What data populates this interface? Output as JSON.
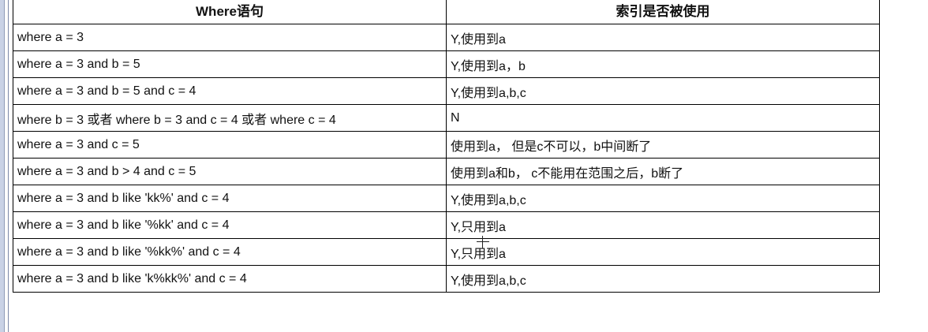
{
  "table": {
    "headers": [
      "Where语句",
      "索引是否被使用"
    ],
    "rows": [
      {
        "where": "where a = 3",
        "used": "Y,使用到a"
      },
      {
        "where": "where a = 3 and b = 5",
        "used": "Y,使用到a，b"
      },
      {
        "where": "where a = 3 and b = 5 and c = 4",
        "used": "Y,使用到a,b,c"
      },
      {
        "where": "where b = 3 或者 where b = 3 and c = 4  或者 where c = 4",
        "used": "N"
      },
      {
        "where": "where a = 3 and c = 5",
        "used": "使用到a， 但是c不可以，b中间断了"
      },
      {
        "where": "where a = 3 and b > 4 and c = 5",
        "used": "使用到a和b， c不能用在范围之后，b断了"
      },
      {
        "where": "where a = 3 and b like 'kk%' and c = 4",
        "used": "Y,使用到a,b,c"
      },
      {
        "where": "where a = 3 and b like '%kk' and c = 4",
        "used": "Y,只用到a"
      },
      {
        "where": "where a = 3 and b like '%kk%' and c = 4",
        "used": "Y,只用到a"
      },
      {
        "where": "where a = 3 and b like 'k%kk%' and c = 4",
        "used": "Y,使用到a,b,c"
      }
    ]
  }
}
